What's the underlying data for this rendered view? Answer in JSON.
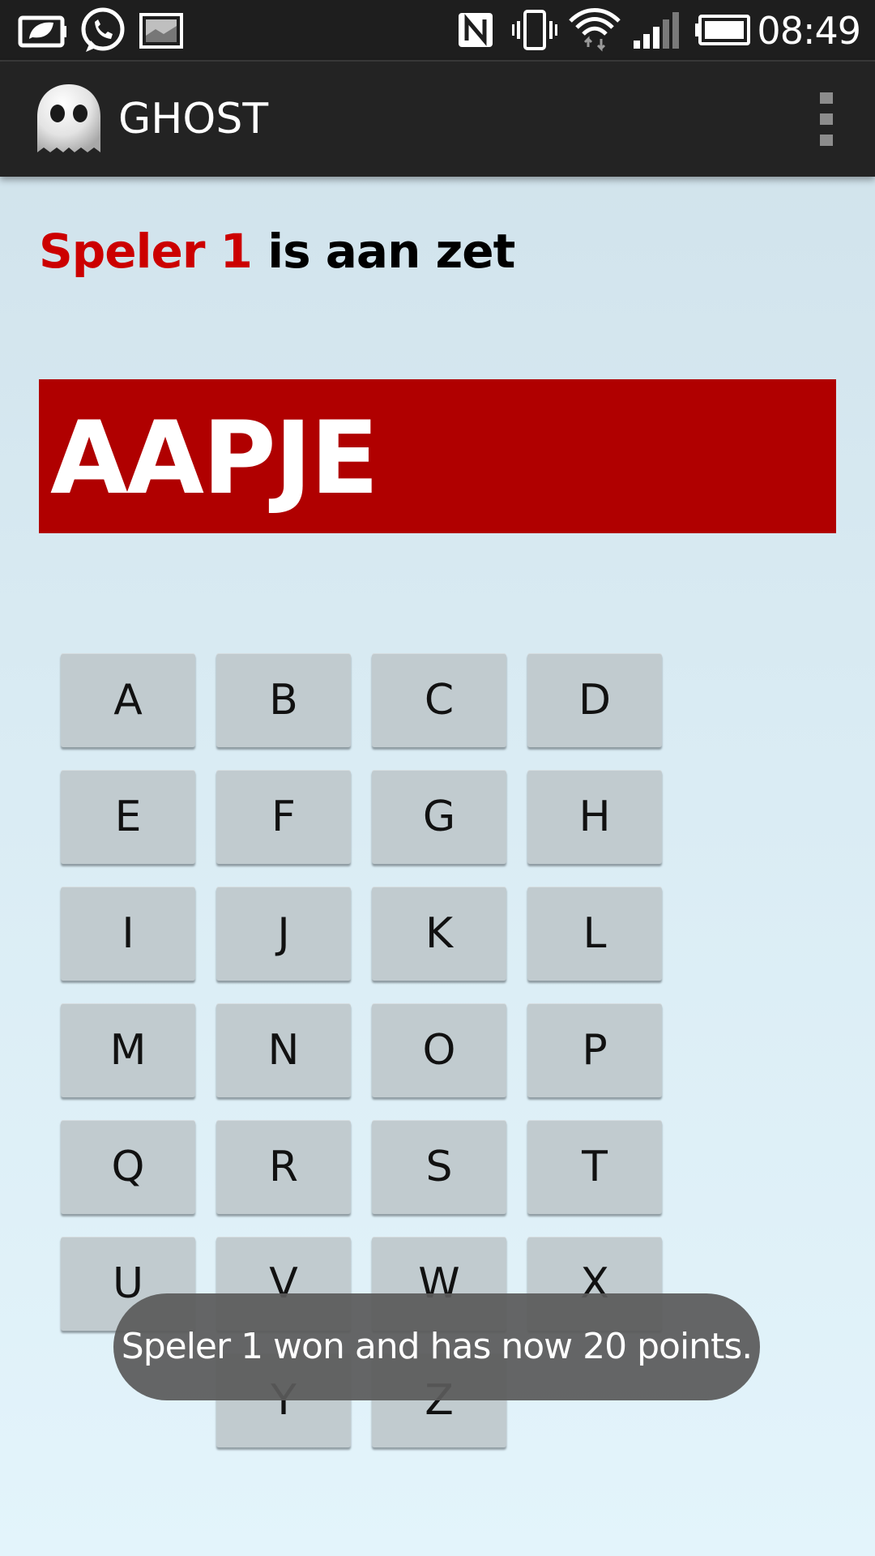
{
  "status_bar": {
    "time": "08:49",
    "icons": [
      "battery-saver-icon",
      "whatsapp-icon",
      "gallery-icon",
      "nfc-icon",
      "vibrate-icon",
      "wifi-icon",
      "signal-icon",
      "battery-icon"
    ]
  },
  "action_bar": {
    "title": "GHOST",
    "logo": "ghost-logo-icon",
    "menu": "overflow-menu-icon"
  },
  "turn": {
    "player": "Speler 1",
    "suffix": " is aan zet"
  },
  "word": "AAPJE",
  "colors": {
    "player_red": "#cc0000",
    "banner_red": "#b00000",
    "key_bg": "#c1cbcf",
    "action_bar": "#232323"
  },
  "keys": [
    "A",
    "B",
    "C",
    "D",
    "E",
    "F",
    "G",
    "H",
    "I",
    "J",
    "K",
    "L",
    "M",
    "N",
    "O",
    "P",
    "Q",
    "R",
    "S",
    "T",
    "U",
    "V",
    "W",
    "X",
    "Y",
    "Z"
  ],
  "toast": "Speler 1 won and has now 20 points."
}
